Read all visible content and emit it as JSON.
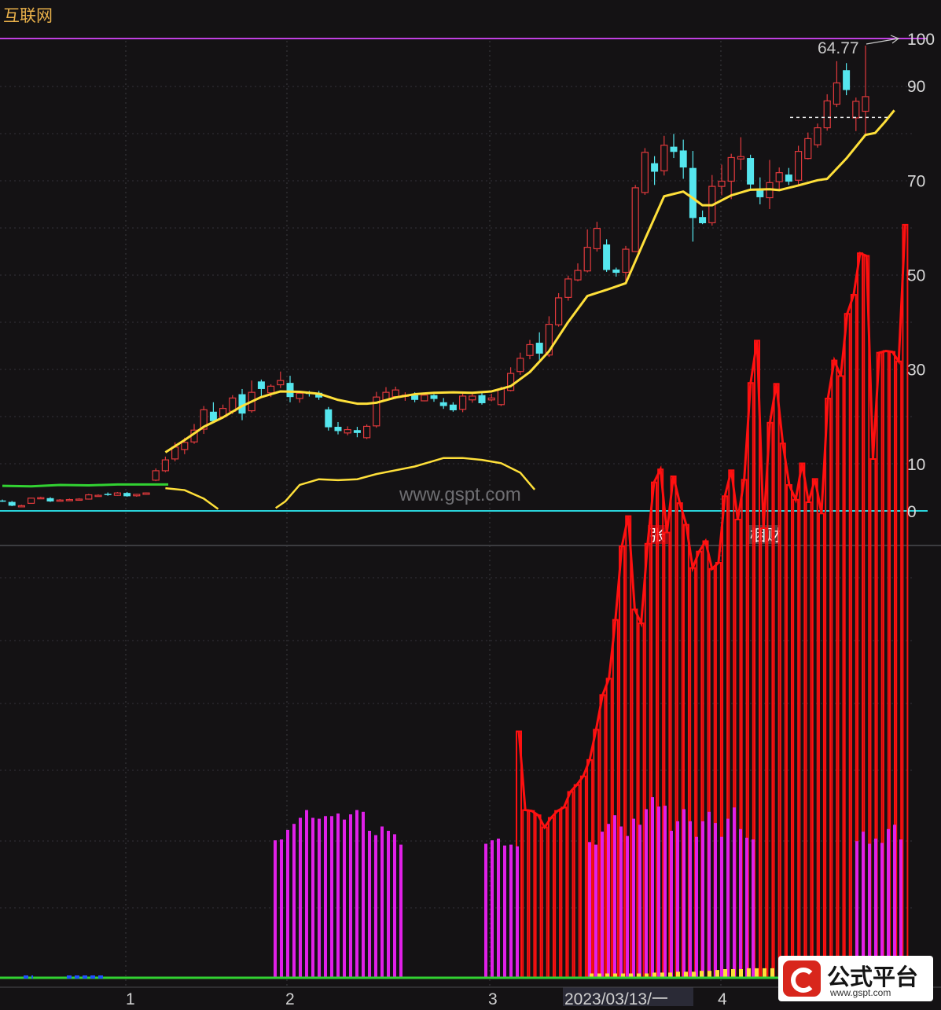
{
  "window_title": "互联网",
  "watermark": "www.gspt.com",
  "logo": {
    "name": "公式平台",
    "url": "www.gspt.com"
  },
  "colors": {
    "background": "#141214",
    "up_candle": "#e0393c",
    "down_candle": "#55e6ee",
    "ma_line": "#ffe03a",
    "green_line": "#32d232",
    "cyan_line": "#2ad3da",
    "purple_line": "#c040e0",
    "red_bars": "#ff1010",
    "magenta_bars": "#e020e8",
    "title": "#e8b04a"
  },
  "markers": [
    {
      "text": "张",
      "bg": "#8a1018",
      "color": "#ffffff"
    },
    {
      "text": "梱财",
      "bg": "#4a4040",
      "color": "#ffffff"
    }
  ],
  "chart_data": [
    {
      "type": "candlestick",
      "y_ticks": [
        0,
        10,
        30,
        50,
        70,
        90,
        100
      ],
      "y_tick_labels": [
        "0",
        "10",
        "30",
        "50",
        "70",
        "90",
        "100"
      ],
      "max_label": "64.77",
      "x_ticks": [
        {
          "label": "1",
          "index": 7
        },
        {
          "label": "2",
          "index": 16
        },
        {
          "label": "3",
          "index": 28
        },
        {
          "label": "2023/03/13/一",
          "index": 34
        },
        {
          "label": "4",
          "index": 41
        }
      ],
      "hlines": [
        {
          "y": 100,
          "color": "#c040e0"
        },
        {
          "y": 0,
          "color": "#2ad3da"
        }
      ],
      "candles": [
        [
          2.2,
          2.1,
          2.4,
          1.9
        ],
        [
          1.9,
          1.1,
          2.1,
          1.0
        ],
        [
          0.9,
          1.1,
          1.3,
          0.8
        ],
        [
          1.6,
          2.7,
          2.8,
          1.5
        ],
        [
          2.7,
          2.8,
          3.0,
          2.6
        ],
        [
          2.7,
          2.0,
          2.9,
          1.9
        ],
        [
          2.1,
          2.3,
          2.5,
          2.0
        ],
        [
          2.3,
          2.4,
          2.6,
          2.2
        ],
        [
          2.4,
          2.5,
          2.7,
          2.3
        ],
        [
          2.5,
          3.4,
          3.6,
          2.4
        ],
        [
          3.3,
          3.3,
          3.5,
          3.1
        ],
        [
          3.6,
          3.5,
          3.9,
          3.2
        ],
        [
          3.3,
          3.8,
          4.0,
          3.2
        ],
        [
          3.8,
          3.1,
          4.0,
          3.0
        ],
        [
          3.2,
          3.5,
          3.6,
          3.0
        ],
        [
          3.5,
          3.8,
          3.9,
          3.4
        ],
        [
          6.5,
          8.5,
          9.0,
          6.3
        ],
        [
          8.5,
          10.8,
          11.5,
          8.2
        ],
        [
          11.0,
          13.5,
          14.5,
          10.5
        ],
        [
          13.0,
          14.5,
          15.5,
          12.0
        ],
        [
          14.6,
          17.1,
          18.4,
          14.2
        ],
        [
          17.3,
          21.4,
          22.2,
          16.3
        ],
        [
          21.0,
          19.0,
          23.0,
          18.8
        ],
        [
          19.9,
          21.7,
          22.5,
          19.5
        ],
        [
          21.1,
          23.9,
          24.5,
          20.5
        ],
        [
          24.7,
          20.6,
          25.8,
          19.2
        ],
        [
          21.2,
          25.1,
          27.6,
          20.8
        ],
        [
          27.4,
          25.8,
          27.8,
          24.3
        ],
        [
          25.0,
          26.4,
          26.8,
          24.1
        ],
        [
          26.7,
          27.6,
          29.5,
          26.0
        ],
        [
          27.1,
          24.1,
          28.6,
          23.0
        ],
        [
          23.8,
          24.9,
          25.3,
          22.9
        ],
        [
          25.0,
          24.8,
          25.4,
          24.2
        ],
        [
          25.0,
          24.0,
          25.4,
          23.5
        ],
        [
          21.5,
          17.7,
          22.0,
          17.0
        ],
        [
          17.8,
          16.9,
          18.8,
          16.2
        ],
        [
          16.5,
          17.2,
          17.9,
          16.0
        ],
        [
          17.1,
          16.5,
          17.8,
          15.6
        ],
        [
          15.5,
          17.9,
          18.3,
          15.2
        ],
        [
          18.0,
          24.1,
          25.2,
          17.6
        ],
        [
          23.5,
          25.1,
          26.2,
          23.2
        ],
        [
          24.2,
          25.6,
          26.3,
          23.7
        ],
        [
          24.5,
          24.5,
          25.1,
          23.3
        ],
        [
          24.5,
          23.5,
          25.1,
          23.0
        ],
        [
          23.3,
          24.5,
          25.0,
          23.2
        ],
        [
          24.5,
          23.7,
          24.7,
          23.1
        ],
        [
          23.0,
          22.2,
          23.9,
          21.6
        ],
        [
          22.5,
          21.3,
          23.0,
          21.0
        ],
        [
          21.5,
          24.3,
          25.0,
          20.9
        ],
        [
          23.5,
          24.3,
          24.8,
          22.9
        ],
        [
          24.5,
          22.8,
          25.1,
          22.5
        ],
        [
          23.5,
          23.9,
          24.8,
          23.2
        ],
        [
          22.5,
          25.8,
          26.3,
          22.2
        ],
        [
          25.5,
          29.1,
          30.4,
          25.3
        ],
        [
          29.5,
          32.3,
          33.5,
          28.8
        ],
        [
          32.9,
          35.2,
          36.2,
          32.1
        ],
        [
          35.6,
          33.3,
          37.8,
          32.0
        ],
        [
          33.0,
          39.5,
          41.2,
          32.6
        ],
        [
          39.4,
          45.1,
          46.1,
          39.0
        ],
        [
          45.2,
          49.1,
          49.8,
          44.5
        ],
        [
          48.9,
          50.9,
          52.4,
          48.6
        ],
        [
          50.8,
          55.8,
          59.6,
          50.5
        ],
        [
          55.5,
          59.8,
          61.2,
          54.9
        ],
        [
          56.4,
          51.0,
          57.5,
          50.6
        ],
        [
          51.1,
          50.4,
          51.5,
          49.6
        ],
        [
          50.5,
          55.4,
          56.1,
          48.3
        ],
        [
          54.9,
          68.4,
          69.0,
          54.8
        ],
        [
          67.4,
          75.9,
          76.8,
          66.9
        ],
        [
          73.6,
          71.8,
          75.1,
          69.0
        ],
        [
          72.0,
          77.4,
          79.4,
          71.0
        ],
        [
          77.1,
          76.0,
          79.8,
          74.7
        ],
        [
          76.3,
          72.7,
          78.6,
          70.3
        ],
        [
          72.6,
          62.0,
          76.2,
          57.0
        ],
        [
          62.2,
          60.9,
          63.6,
          60.7
        ],
        [
          61.0,
          68.7,
          71.1,
          60.4
        ],
        [
          68.7,
          69.8,
          73.3,
          66.8
        ],
        [
          69.8,
          74.8,
          75.6,
          66.0
        ],
        [
          74.5,
          75.0,
          79.1,
          72.2
        ],
        [
          74.7,
          69.1,
          75.4,
          68.1
        ],
        [
          68.2,
          66.4,
          70.6,
          64.9
        ],
        [
          66.3,
          69.5,
          74.3,
          63.9
        ],
        [
          69.7,
          71.6,
          72.7,
          68.0
        ],
        [
          71.2,
          69.7,
          72.6,
          69.0
        ],
        [
          70.0,
          76.1,
          77.3,
          69.1
        ],
        [
          74.6,
          78.8,
          80.1,
          74.4
        ],
        [
          77.5,
          81.1,
          82.0,
          76.9
        ],
        [
          81.1,
          86.8,
          88.2,
          80.5
        ],
        [
          86.1,
          90.6,
          95.2,
          85.5
        ],
        [
          93.3,
          89.1,
          94.8,
          88.0
        ],
        [
          83.2,
          86.7,
          87.5,
          80.4
        ],
        [
          84.6,
          87.7,
          98.5,
          79.4
        ]
      ],
      "ma_line": [
        [
          17,
          12.4
        ],
        [
          19,
          15.0
        ],
        [
          21,
          17.8
        ],
        [
          23,
          19.8
        ],
        [
          25,
          22.2
        ],
        [
          27,
          24.1
        ],
        [
          29,
          25.3
        ],
        [
          31,
          25.2
        ],
        [
          33,
          24.8
        ],
        [
          35,
          23.5
        ],
        [
          37,
          22.7
        ],
        [
          38,
          22.7
        ],
        [
          39,
          22.9
        ],
        [
          41,
          24.0
        ],
        [
          43,
          24.7
        ],
        [
          45,
          25.0
        ],
        [
          47,
          25.1
        ],
        [
          49,
          25.0
        ],
        [
          51,
          25.3
        ],
        [
          53,
          26.4
        ],
        [
          55,
          29.4
        ],
        [
          57,
          33.8
        ],
        [
          59,
          40.0
        ],
        [
          61,
          45.5
        ],
        [
          63,
          46.8
        ],
        [
          65,
          48.2
        ],
        [
          67,
          57.5
        ],
        [
          69,
          66.6
        ],
        [
          71,
          67.6
        ],
        [
          72,
          66.2
        ],
        [
          73,
          64.7
        ],
        [
          74,
          64.7
        ],
        [
          76,
          66.8
        ],
        [
          78,
          68.0
        ],
        [
          80,
          68.1
        ],
        [
          81,
          67.9
        ],
        [
          83,
          68.9
        ],
        [
          85,
          70.0
        ],
        [
          86,
          70.3
        ],
        [
          88,
          74.6
        ],
        [
          90,
          79.6
        ],
        [
          91,
          80.0
        ],
        [
          92,
          82.3
        ],
        [
          93,
          84.8
        ]
      ],
      "green_line": [
        [
          0,
          5.3
        ],
        [
          3,
          5.2
        ],
        [
          6,
          5.5
        ],
        [
          9,
          5.4
        ],
        [
          12,
          5.6
        ],
        [
          15,
          5.6
        ],
        [
          16.6,
          5.6
        ],
        [
          17.3,
          5.6
        ]
      ],
      "curve_a": [
        [
          17,
          4.8
        ],
        [
          19,
          4.4
        ],
        [
          21,
          2.6
        ],
        [
          22.5,
          0.4
        ]
      ],
      "curve_b": [
        [
          28.5,
          0.6
        ],
        [
          29.5,
          2.0
        ],
        [
          31,
          5.5
        ],
        [
          33,
          6.7
        ],
        [
          35,
          6.5
        ],
        [
          37,
          6.7
        ],
        [
          39,
          7.8
        ],
        [
          41,
          8.6
        ],
        [
          43,
          9.4
        ],
        [
          45,
          10.6
        ],
        [
          46,
          11.2
        ],
        [
          48,
          11.2
        ],
        [
          50,
          10.8
        ],
        [
          52,
          10.1
        ],
        [
          54,
          8.1
        ],
        [
          55.5,
          4.5
        ]
      ]
    },
    {
      "type": "bar",
      "red_bars": [
        28.5,
        19.4,
        19.3,
        18.8,
        17.4,
        18.5,
        19.3,
        19.7,
        21.5,
        22.3,
        23.3,
        25.2,
        28.7,
        32.7,
        34.6,
        41.4,
        49.9,
        53.4,
        42.6,
        41.0,
        50.2,
        57.3,
        58.8,
        51.5,
        58.0,
        54.9,
        52.4,
        47.4,
        49.3,
        50.5,
        47.3,
        48.0,
        55.7,
        58.7,
        53.0,
        57.6,
        68.8,
        73.7,
        52.0,
        64.2,
        68.7,
        61.8,
        57.0,
        55.3,
        59.5,
        55.0,
        57.7,
        53.7,
        67.0,
        71.4,
        69.6,
        76.8,
        79.0,
        83.8,
        83.5,
        60.0,
        72.3,
        72.5,
        72.4,
        71.3,
        87.1
      ],
      "magenta_bars": [
        [
          350,
          15.9
        ],
        [
          358,
          16.0
        ],
        [
          366,
          17.1
        ],
        [
          374,
          17.8
        ],
        [
          382,
          18.5
        ],
        [
          390,
          19.4
        ],
        [
          398,
          18.5
        ],
        [
          406,
          18.4
        ],
        [
          414,
          18.7
        ],
        [
          422,
          18.7
        ],
        [
          430,
          19.0
        ],
        [
          438,
          18.3
        ],
        [
          446,
          18.9
        ],
        [
          454,
          19.4
        ],
        [
          462,
          19.2
        ],
        [
          470,
          17.0
        ],
        [
          478,
          16.5
        ],
        [
          486,
          17.5
        ],
        [
          494,
          17.0
        ],
        [
          502,
          16.6
        ],
        [
          510,
          15.4
        ],
        [
          618,
          15.5
        ],
        [
          626,
          15.9
        ],
        [
          634,
          16.1
        ],
        [
          642,
          15.3
        ],
        [
          650,
          15.4
        ],
        [
          658,
          15.2
        ],
        [
          750,
          15.7
        ],
        [
          758,
          15.4
        ],
        [
          766,
          16.9
        ],
        [
          774,
          17.8
        ],
        [
          782,
          18.8
        ],
        [
          790,
          17.5
        ],
        [
          798,
          16.4
        ],
        [
          806,
          18.4
        ],
        [
          814,
          17.7
        ],
        [
          822,
          19.5
        ],
        [
          830,
          20.9
        ],
        [
          838,
          19.8
        ],
        [
          846,
          19.9
        ],
        [
          854,
          17.0
        ],
        [
          862,
          18.1
        ],
        [
          870,
          19.5
        ],
        [
          878,
          18.1
        ],
        [
          886,
          16.3
        ],
        [
          894,
          18.1
        ],
        [
          902,
          19.2
        ],
        [
          910,
          17.9
        ],
        [
          918,
          16.3
        ],
        [
          926,
          18.4
        ],
        [
          934,
          19.7
        ],
        [
          942,
          17.2
        ],
        [
          950,
          16.2
        ],
        [
          958,
          16.0
        ],
        [
          1090,
          15.8
        ],
        [
          1098,
          16.9
        ],
        [
          1106,
          15.5
        ],
        [
          1114,
          16.1
        ],
        [
          1122,
          15.6
        ],
        [
          1130,
          17.2
        ],
        [
          1138,
          17.7
        ],
        [
          1146,
          16.0
        ]
      ],
      "yellow_bars": [
        [
          750,
          0.5
        ],
        [
          760,
          0.5
        ],
        [
          770,
          0.5
        ],
        [
          780,
          0.5
        ],
        [
          790,
          0.5
        ],
        [
          800,
          0.5
        ],
        [
          810,
          0.5
        ],
        [
          820,
          0.5
        ],
        [
          830,
          0.6
        ],
        [
          840,
          0.6
        ],
        [
          850,
          0.6
        ],
        [
          860,
          0.7
        ],
        [
          870,
          0.7
        ],
        [
          880,
          0.7
        ],
        [
          890,
          0.8
        ],
        [
          900,
          0.8
        ],
        [
          910,
          0.9
        ],
        [
          920,
          1.0
        ],
        [
          930,
          1.0
        ],
        [
          940,
          1.0
        ],
        [
          950,
          1.1
        ],
        [
          960,
          1.1
        ],
        [
          970,
          1.1
        ],
        [
          980,
          1.1
        ]
      ],
      "blue_dashes": [
        [
          30,
          42
        ],
        [
          85,
          92
        ],
        [
          95,
          135
        ]
      ]
    }
  ]
}
